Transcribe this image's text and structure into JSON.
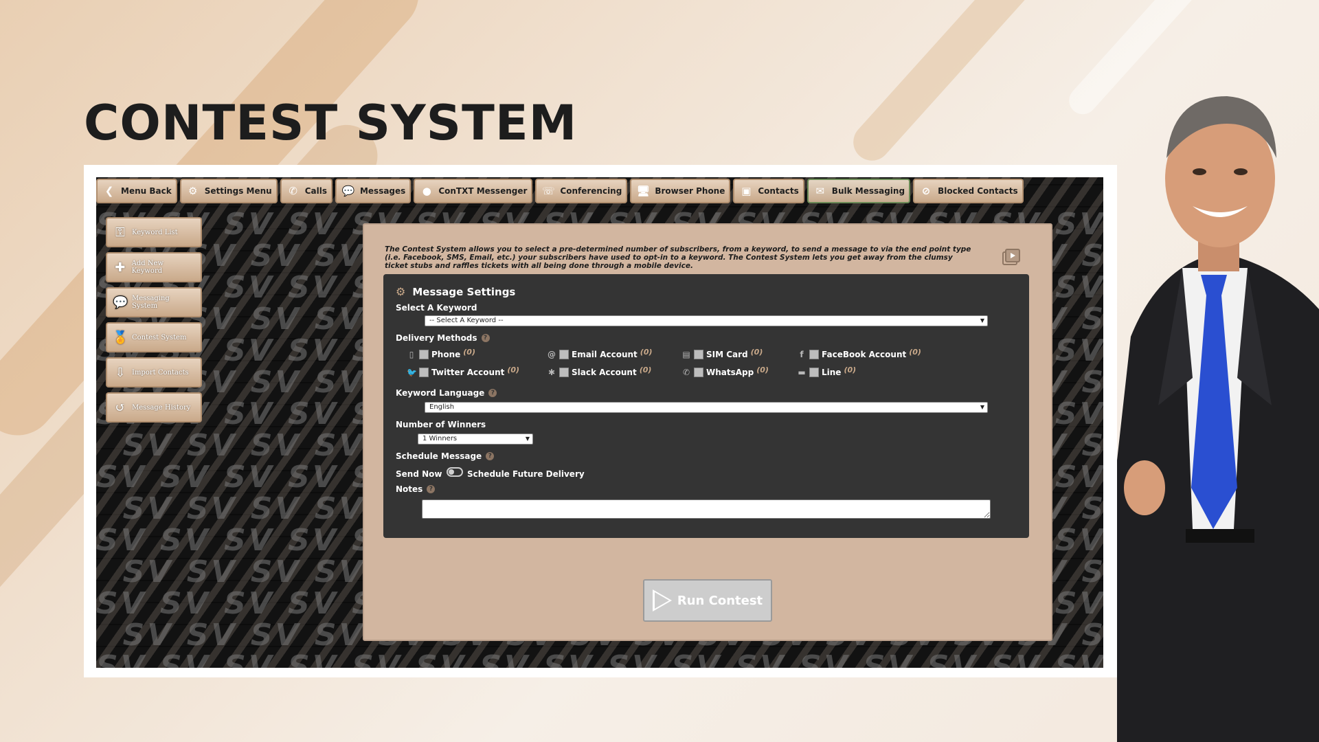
{
  "page_title": "CONTEST SYSTEM",
  "topnav": [
    {
      "label": "Menu Back",
      "icon": "back-arrow-icon",
      "glyph": "❮"
    },
    {
      "label": "Settings Menu",
      "icon": "gear-icon",
      "glyph": "⚙"
    },
    {
      "label": "Calls",
      "icon": "phone-icon",
      "glyph": "✆"
    },
    {
      "label": "Messages",
      "icon": "chat-bubbles-icon",
      "glyph": "💬"
    },
    {
      "label": "ConTXT Messenger",
      "icon": "speech-bubble-icon",
      "glyph": "●"
    },
    {
      "label": "Conferencing",
      "icon": "conference-icon",
      "glyph": "☏"
    },
    {
      "label": "Browser Phone",
      "icon": "monitor-phone-icon",
      "glyph": "🖥"
    },
    {
      "label": "Contacts",
      "icon": "contact-card-icon",
      "glyph": "▣"
    },
    {
      "label": "Bulk Messaging",
      "icon": "bulk-message-icon",
      "glyph": "✉",
      "active": true
    },
    {
      "label": "Blocked Contacts",
      "icon": "blocked-contact-icon",
      "glyph": "⊘"
    }
  ],
  "sidebar": [
    {
      "label": "Keyword List",
      "icon": "key-icon",
      "glyph": "⚿"
    },
    {
      "label": "Add New Keyword",
      "icon": "add-key-icon",
      "glyph": "✚"
    },
    {
      "label": "Messaging System",
      "icon": "chat-bubbles-icon",
      "glyph": "💬"
    },
    {
      "label": "Contest System",
      "icon": "medal-icon",
      "glyph": "🏅"
    },
    {
      "label": "Import Contacts",
      "icon": "import-file-icon",
      "glyph": "⇩"
    },
    {
      "label": "Message History",
      "icon": "history-icon",
      "glyph": "↺"
    }
  ],
  "intro_text": "The Contest System allows you to select a pre-determined number of subscribers, from a keyword, to send a message to via the end point type (i.e. Facebook, SMS, Email, etc.) your subscribers have used to opt-in to a keyword. The Contest System lets you get away from the clumsy ticket stubs and raffles tickets with all being done through a mobile device.",
  "settings": {
    "header": "Message Settings",
    "select_keyword_label": "Select A Keyword",
    "select_keyword_value": "-- Select A Keyword --",
    "delivery_methods_label": "Delivery Methods",
    "delivery_methods": [
      {
        "label": "Phone",
        "count": "(0)",
        "icon": "mobile-phone-icon",
        "glyph": "▯"
      },
      {
        "label": "Email Account",
        "count": "(0)",
        "icon": "at-sign-icon",
        "glyph": "@"
      },
      {
        "label": "SIM Card",
        "count": "(0)",
        "icon": "sim-card-icon",
        "glyph": "▤"
      },
      {
        "label": "FaceBook Account",
        "count": "(0)",
        "icon": "facebook-icon",
        "glyph": "f"
      },
      {
        "label": "Twitter Account",
        "count": "(0)",
        "icon": "twitter-icon",
        "glyph": "🐦"
      },
      {
        "label": "Slack Account",
        "count": "(0)",
        "icon": "slack-icon",
        "glyph": "✱"
      },
      {
        "label": "WhatsApp",
        "count": "(0)",
        "icon": "whatsapp-icon",
        "glyph": "✆"
      },
      {
        "label": "Line",
        "count": "(0)",
        "icon": "line-app-icon",
        "glyph": "▬"
      }
    ],
    "keyword_language_label": "Keyword Language",
    "keyword_language_value": "English",
    "winners_label": "Number of Winners",
    "winners_value": "1 Winners",
    "schedule_label": "Schedule Message",
    "send_now_label": "Send Now",
    "schedule_future_label": "Schedule Future Delivery",
    "notes_label": "Notes",
    "notes_value": ""
  },
  "run_button_label": "Run Contest",
  "colors": {
    "accent": "#c9a98a",
    "panel": "#d2b6a0",
    "settings_bg": "#343434"
  }
}
